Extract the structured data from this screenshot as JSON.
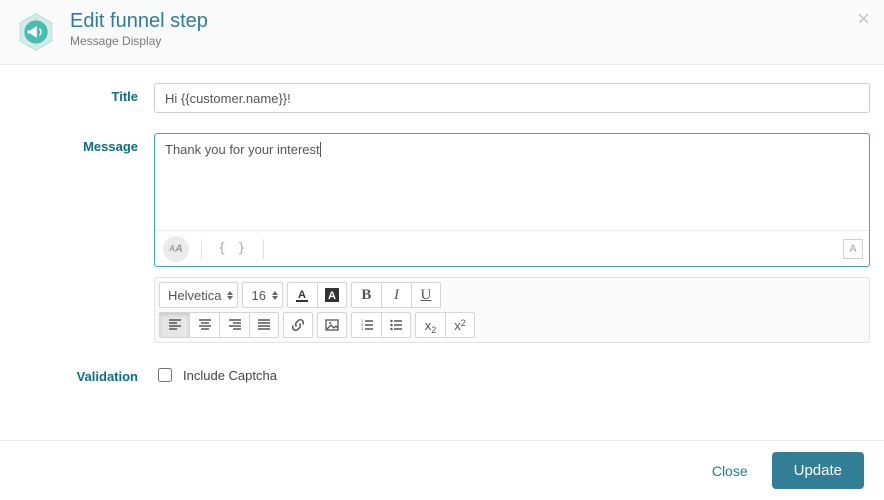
{
  "header": {
    "title": "Edit funnel step",
    "subtitle": "Message Display"
  },
  "labels": {
    "title": "Title",
    "message": "Message",
    "validation": "Validation"
  },
  "title_field": {
    "value": "Hi {{customer.name}}!"
  },
  "message_field": {
    "value": "Thank you for your interest"
  },
  "toolbar": {
    "font_family": "Helvetica",
    "font_size": "16"
  },
  "validation": {
    "captcha_label": "Include Captcha",
    "captcha_checked": false
  },
  "footer": {
    "close": "Close",
    "update": "Update"
  }
}
